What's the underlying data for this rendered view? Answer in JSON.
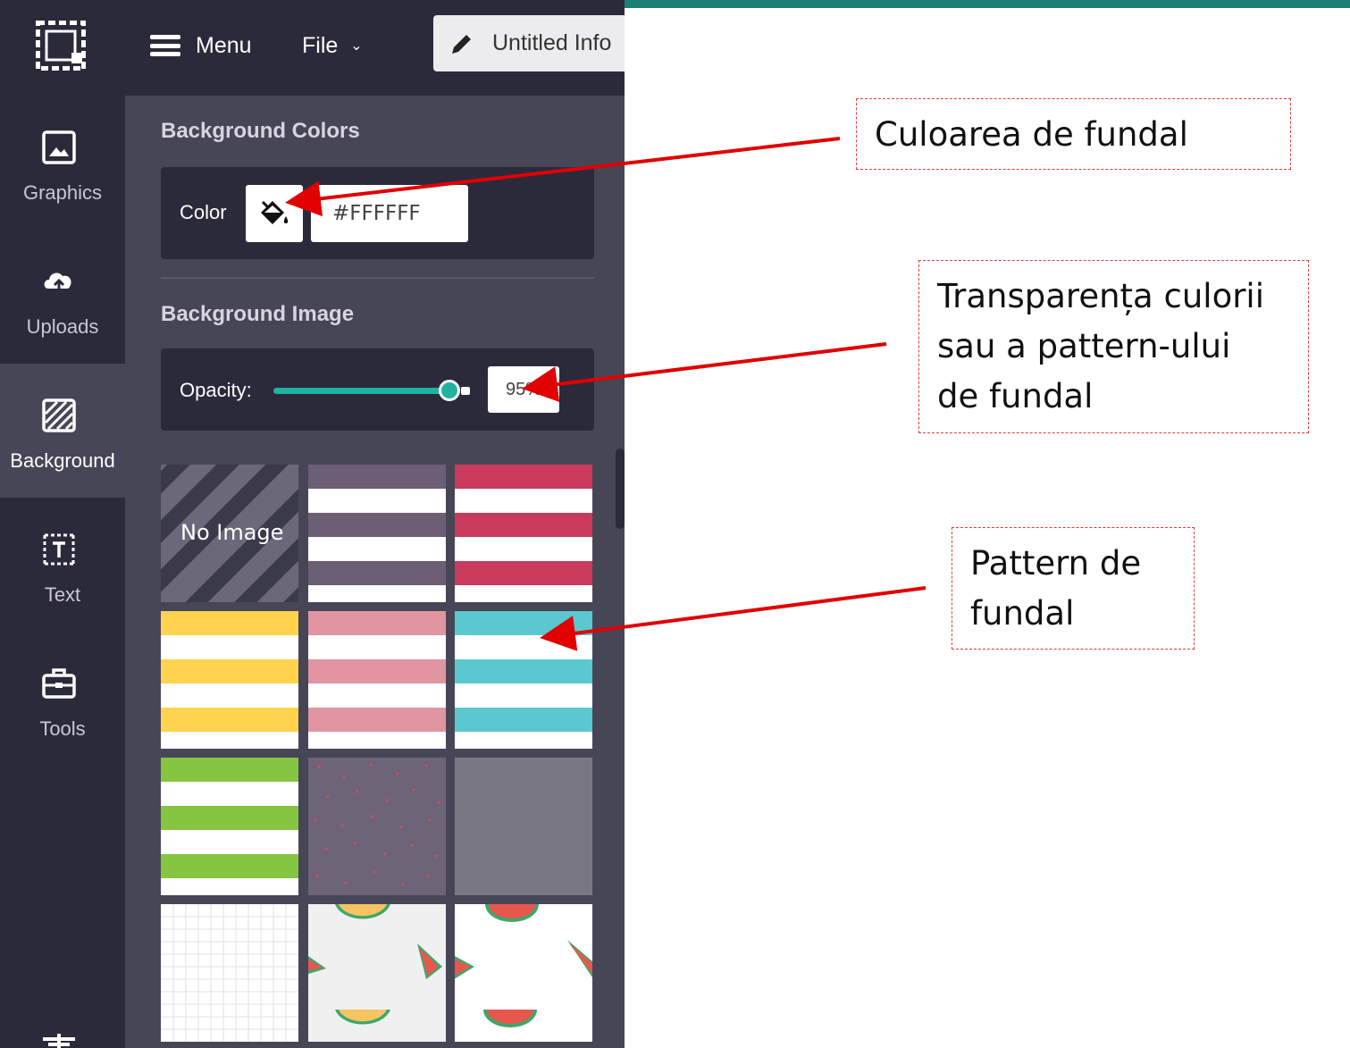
{
  "header": {
    "menu_label": "Menu",
    "file_label": "File",
    "title_value": "Untitled Info"
  },
  "rail": [
    {
      "label": "Graphics",
      "icon": "image-icon",
      "active": false
    },
    {
      "label": "Uploads",
      "icon": "cloud-upload-icon",
      "active": false
    },
    {
      "label": "Background",
      "icon": "hatch-icon",
      "active": true
    },
    {
      "label": "Text",
      "icon": "text-box-icon",
      "active": false
    },
    {
      "label": "Tools",
      "icon": "toolbox-icon",
      "active": false
    }
  ],
  "panel": {
    "bg_colors_title": "Background Colors",
    "color_label": "Color",
    "color_value": "#FFFFFF",
    "bg_image_title": "Background Image",
    "opacity_label": "Opacity:",
    "opacity_value": "95%",
    "opacity_fraction": 0.95,
    "no_image_label": "No Image"
  },
  "colors": {
    "accent": "#1fb3a0",
    "header_strip": "#1e7f73",
    "app_dark": "#2b2a3b",
    "panel": "#474657",
    "callout_border": "#e03c3c"
  },
  "patterns": [
    {
      "name": "no-image-tile"
    },
    {
      "name": "stripes-purple-tile",
      "color": "#6b5e75"
    },
    {
      "name": "stripes-red-tile",
      "color": "#c93a5c"
    },
    {
      "name": "stripes-yellow-tile",
      "color": "#ffd34e"
    },
    {
      "name": "stripes-pink-tile",
      "color": "#e195a2"
    },
    {
      "name": "stripes-teal-tile",
      "color": "#5bc8d0"
    },
    {
      "name": "stripes-green-tile",
      "color": "#86c540"
    },
    {
      "name": "dots-tile",
      "color": "#6e6477"
    },
    {
      "name": "solid-gray-tile",
      "color": "#7a7784"
    },
    {
      "name": "grid-tile",
      "color": "#ffffff"
    },
    {
      "name": "watermelon-gray-tile",
      "color": "#f0f0f0"
    },
    {
      "name": "watermelon-white-tile",
      "color": "#ffffff"
    }
  ],
  "callouts": {
    "color": "Culoarea de fundal",
    "opacity_lines": [
      "Transparența culorii",
      "sau a pattern-ului",
      "de fundal"
    ],
    "pattern_lines": [
      "Pattern de",
      "fundal"
    ]
  }
}
